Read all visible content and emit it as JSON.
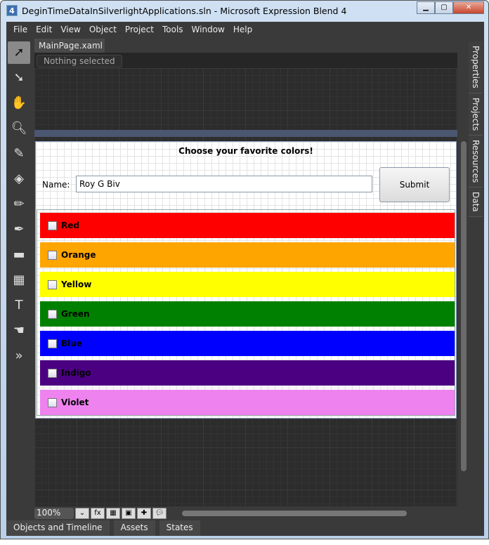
{
  "window": {
    "title": "DeginTimeDataInSilverlightApplications.sln - Microsoft Expression Blend 4",
    "app_icon": "4"
  },
  "menu": [
    "File",
    "Edit",
    "View",
    "Object",
    "Project",
    "Tools",
    "Window",
    "Help"
  ],
  "document_tab": {
    "label": "MainPage.xaml",
    "close": "×"
  },
  "selection_status": "Nothing selected",
  "form": {
    "title": "Choose your favorite colors!",
    "name_label": "Name:",
    "name_value": "Roy G Biv",
    "submit_label": "Submit",
    "colors": [
      {
        "label": "Red",
        "color": "#ff0000"
      },
      {
        "label": "Orange",
        "color": "#ffa500"
      },
      {
        "label": "Yellow",
        "color": "#ffff00"
      },
      {
        "label": "Green",
        "color": "#008000"
      },
      {
        "label": "Blue",
        "color": "#0000ff"
      },
      {
        "label": "Indigo",
        "color": "#4b0082"
      },
      {
        "label": "Violet",
        "color": "#ee82ee"
      }
    ]
  },
  "right_tabs": [
    "Properties",
    "Projects",
    "Resources",
    "Data"
  ],
  "zoom_level": "100%",
  "bottom_tabs": [
    "Objects and Timeline",
    "Assets",
    "States"
  ]
}
